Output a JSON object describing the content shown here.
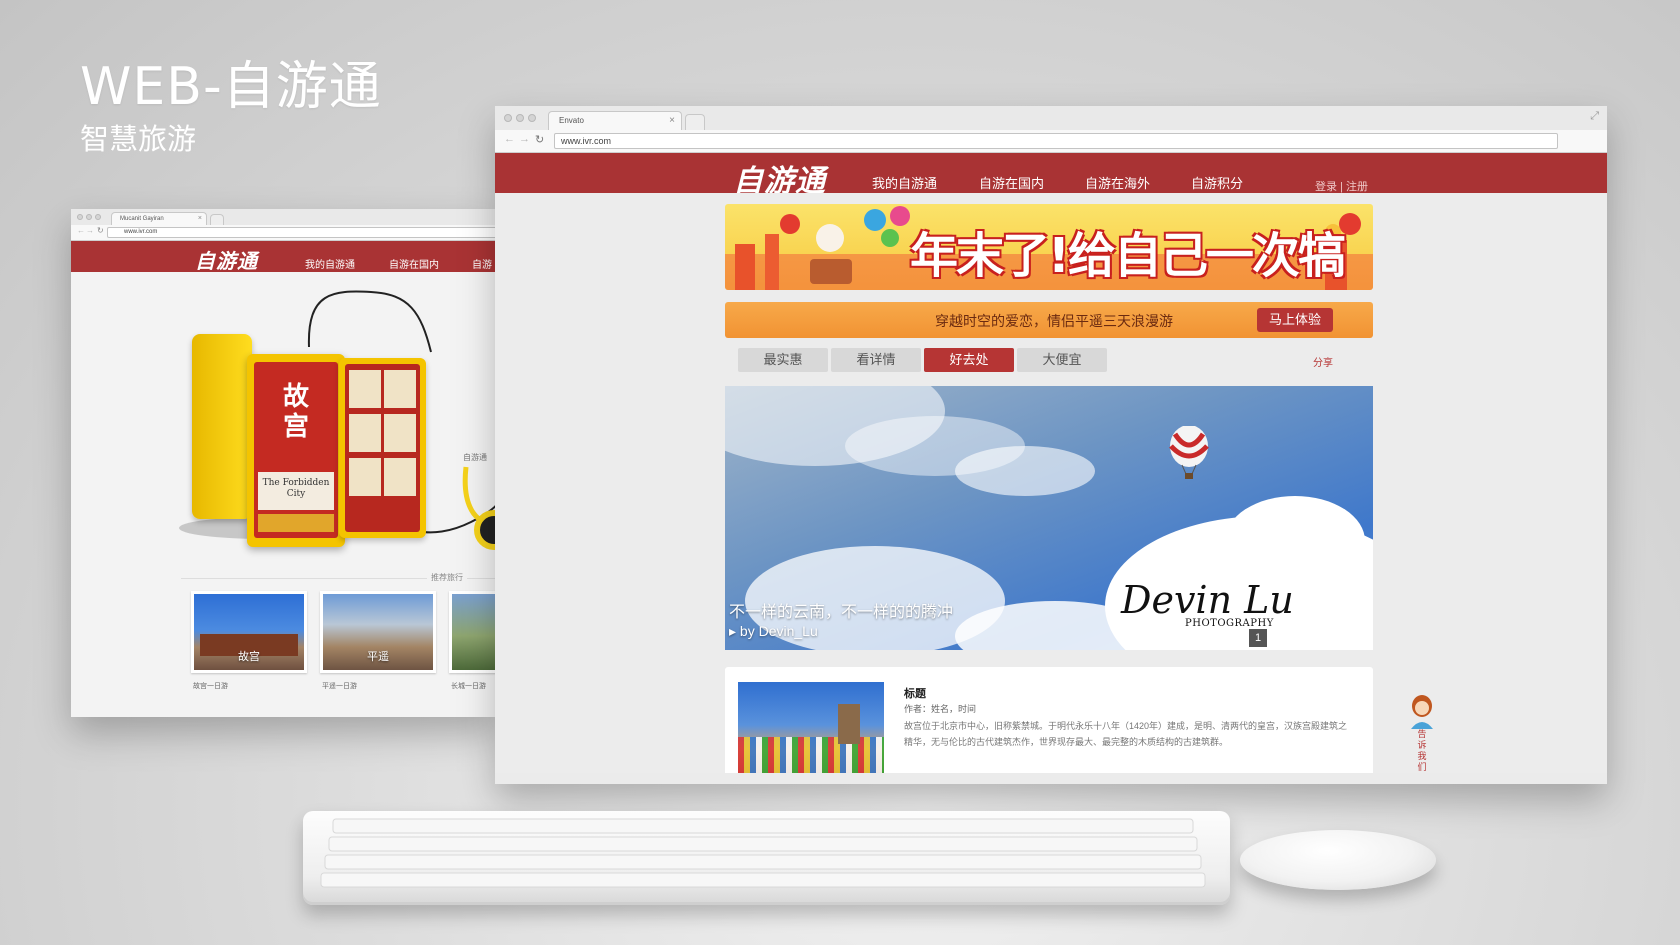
{
  "hero": {
    "title": "WEB-自游通",
    "subtitle": "智慧旅游"
  },
  "colors": {
    "brand_red": "#a93334",
    "accent_orange": "#f19333",
    "sky_blue": "#3f78cb"
  },
  "back_window": {
    "tab_title": "Mucanit Gayiran",
    "url": "www.ivr.com",
    "logo": "自游通",
    "nav": [
      "我的自游通",
      "自游在国内",
      "自游"
    ],
    "side_label": "自游通",
    "device": {
      "cover_title": "故宫",
      "cover_subtitle_en": "The Forbidden City"
    },
    "section_title": "推荐旅行",
    "thumbnails": [
      {
        "label": "故宫",
        "caption": "故宫一日游"
      },
      {
        "label": "平遥",
        "caption": "平遥一日游"
      },
      {
        "label": "",
        "caption": "长城一日游"
      }
    ]
  },
  "front_window": {
    "tab_title": "Envato",
    "url": "www.ivr.com",
    "logo": "自游通",
    "nav": [
      "我的自游通",
      "自游在国内",
      "自游在海外",
      "自游积分"
    ],
    "auth": "登录 | 注册",
    "banner_text": "年末了!给自己一次犒赏之旅",
    "promo": {
      "text": "穿越时空的爱恋，情侣平遥三天浪漫游",
      "button": "马上体验"
    },
    "tabs": [
      {
        "label": "最实惠",
        "active": false
      },
      {
        "label": "看详情",
        "active": false
      },
      {
        "label": "好去处",
        "active": true
      },
      {
        "label": "大便宜",
        "active": false
      }
    ],
    "share": "分享",
    "slide": {
      "caption": "不一样的云南，不一样的的腾冲",
      "by": "▸ by Devin_Lu",
      "watermark": "Devin Lu",
      "watermark_sub": "PHOTOGRAPHY",
      "current_page": "1"
    },
    "article": {
      "title": "标题",
      "meta": "作者：姓名，时间",
      "body": "故宫位于北京市中心，旧称紫禁城。于明代永乐十八年（1420年）建成，是明、清两代的皇宫，汉族宫殿建筑之精华，无与伦比的古代建筑杰作，世界现存最大、最完整的木质结构的古建筑群。"
    },
    "contact": "告\n诉\n我\n们"
  }
}
